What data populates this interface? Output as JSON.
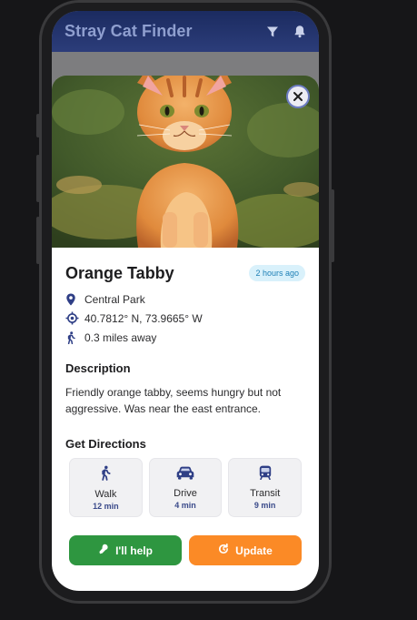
{
  "app": {
    "title": "Stray Cat Finder"
  },
  "header_icons": [
    "filter-icon",
    "bell-icon"
  ],
  "cat": {
    "name": "Orange Tabby",
    "time_ago": "2 hours ago",
    "location": "Central Park",
    "coordinates": "40.7812° N, 73.9665° W",
    "distance": "0.3 miles away"
  },
  "description": {
    "heading": "Description",
    "text": "Friendly orange tabby, seems hungry but not aggressive. Was near the east entrance."
  },
  "directions": {
    "heading": "Get Directions",
    "options": [
      {
        "label": "Walk",
        "time": "12 min",
        "icon": "walk-icon"
      },
      {
        "label": "Drive",
        "time": "4 min",
        "icon": "car-icon"
      },
      {
        "label": "Transit",
        "time": "9 min",
        "icon": "bus-icon"
      }
    ]
  },
  "actions": {
    "help_label": "I'll help",
    "update_label": "Update"
  },
  "colors": {
    "appbar": "#2c3d7a",
    "help": "#2e9640",
    "update": "#fb8a26",
    "badge_bg": "#d9f1fb",
    "badge_text": "#1f80b6"
  }
}
